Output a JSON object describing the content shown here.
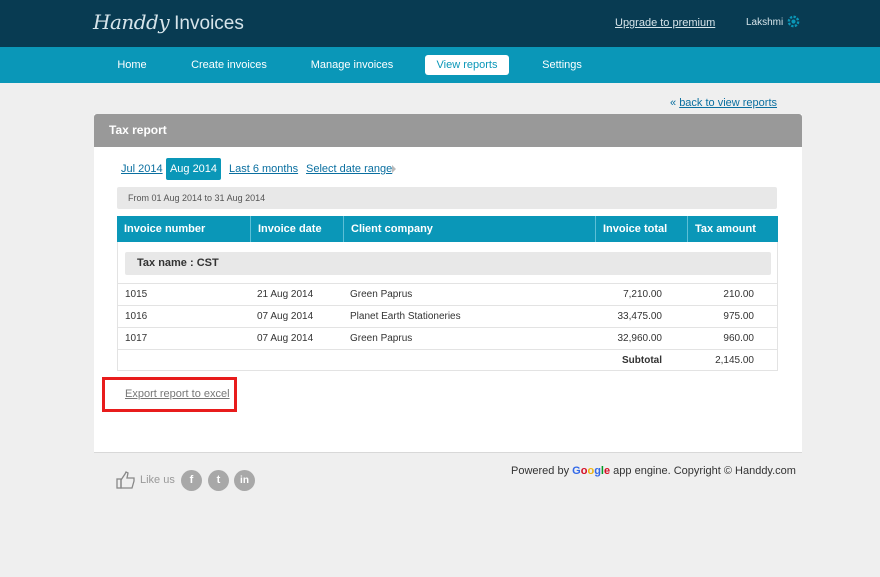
{
  "header": {
    "logo_script": "Handdy",
    "logo_plain": "Invoices",
    "upgrade_label": "Upgrade to premium",
    "user_name": "Lakshmi",
    "settings_icon": "gear-icon"
  },
  "nav": {
    "items": [
      {
        "label": "Home"
      },
      {
        "label": "Create invoices"
      },
      {
        "label": "Manage invoices"
      },
      {
        "label": "View reports",
        "active": true
      },
      {
        "label": "Settings"
      }
    ]
  },
  "back_link": {
    "icon": "«",
    "label": "back to view reports"
  },
  "panel": {
    "title": "Tax report",
    "periods": [
      {
        "label": "Jul 2014"
      },
      {
        "label": "Aug 2014",
        "active": true
      },
      {
        "label": "Last 6 months"
      },
      {
        "label": "Select date range"
      }
    ],
    "date_range": "From 01 Aug 2014 to 31 Aug 2014",
    "table": {
      "columns": [
        "Invoice number",
        "Invoice date",
        "Client company",
        "Invoice total",
        "Tax amount"
      ],
      "tax_name": "Tax name : CST",
      "rows": [
        {
          "number": "1015",
          "date": "21 Aug 2014",
          "client": "Green Paprus",
          "total": "7,210.00",
          "tax": "210.00"
        },
        {
          "number": "1016",
          "date": "07 Aug 2014",
          "client": "Planet Earth Stationeries",
          "total": "33,475.00",
          "tax": "975.00"
        },
        {
          "number": "1017",
          "date": "07 Aug 2014",
          "client": "Green Paprus",
          "total": "32,960.00",
          "tax": "960.00"
        }
      ],
      "subtotal_label": "Subtotal",
      "subtotal_value": "2,145.00"
    },
    "export_label": "Export report to excel"
  },
  "footer": {
    "like_label": "Like us",
    "social": [
      {
        "icon": "facebook-icon",
        "glyph": "f"
      },
      {
        "icon": "twitter-icon",
        "glyph": "t"
      },
      {
        "icon": "linkedin-icon",
        "glyph": "in"
      }
    ],
    "powered_prefix": "Powered by",
    "google": [
      "G",
      "o",
      "o",
      "g",
      "l",
      "e"
    ],
    "powered_suffix": "app engine. Copyright © Handdy.com"
  },
  "colors": {
    "topbar": "#083b52",
    "navbar": "#0a97b8",
    "accent": "#0a97b8",
    "highlight_box": "#e81c1c"
  }
}
